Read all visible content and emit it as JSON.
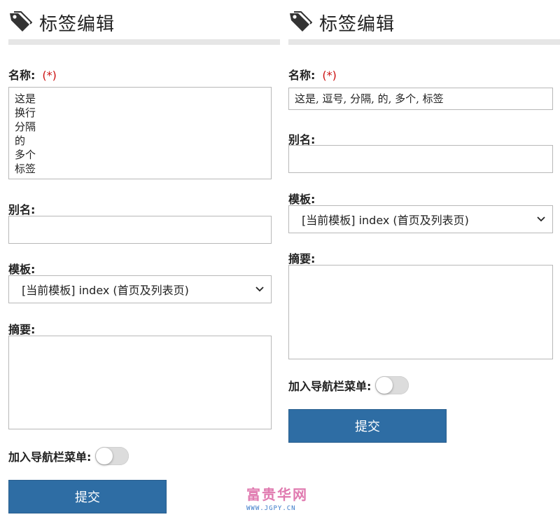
{
  "left": {
    "title": "标签编辑",
    "name_label": "名称:",
    "required_mark": "(*)",
    "name_value": "这是\n换行\n分隔\n的\n多个\n标签",
    "alias_label": "别名:",
    "alias_value": "",
    "template_label": "模板:",
    "template_selected": "[当前模板] index (首页及列表页)",
    "summary_label": "摘要:",
    "summary_value": "",
    "nav_label": "加入导航栏菜单:",
    "nav_enabled": false,
    "submit_label": "提交"
  },
  "right": {
    "title": "标签编辑",
    "name_label": "名称:",
    "required_mark": "(*)",
    "name_value": "这是, 逗号, 分隔, 的, 多个, 标签",
    "alias_label": "别名:",
    "alias_value": "",
    "template_label": "模板:",
    "template_selected": "[当前模板] index (首页及列表页)",
    "summary_label": "摘要:",
    "summary_value": "",
    "nav_label": "加入导航栏菜单:",
    "nav_enabled": false,
    "submit_label": "提交"
  },
  "watermark": {
    "text": "富贵华网",
    "url": "WWW.JGPY.CN"
  },
  "colors": {
    "accent": "#2e6da4",
    "required": "#cc1111",
    "divider": "#e6e6e6"
  },
  "icons": [
    "tag-icon",
    "chevron-down-icon"
  ]
}
